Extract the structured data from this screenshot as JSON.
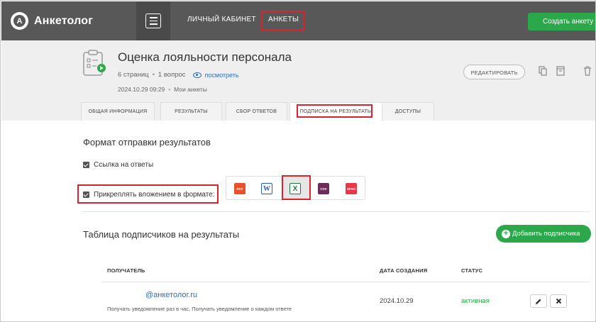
{
  "topbar": {
    "logo_letter": "A",
    "logo_text": "Анкетолог",
    "nav": {
      "cabinet": "ЛИЧНЫЙ КАБИНЕТ",
      "surveys": "АНКЕТЫ"
    },
    "create_button": "Создать анкету"
  },
  "survey": {
    "title": "Оценка лояльности персонала",
    "pages": "6 страниц",
    "questions": "1 вопрос",
    "view_link": "посмотреть",
    "date": "2024.10.29 09:29",
    "folder": "Мои анкеты",
    "edit_button": "РЕДАКТИРОВАТЬ"
  },
  "tabs": [
    {
      "label": "ОБЩАЯ ИНФОРМАЦИЯ"
    },
    {
      "label": "РЕЗУЛЬТАТЫ"
    },
    {
      "label": "СБОР ОТВЕТОВ"
    },
    {
      "label": "ПОДПИСКА НА РЕЗУЛЬТАТЫ"
    },
    {
      "label": "ДОСТУПЫ"
    }
  ],
  "active_tab": "ПОДПИСКА НА РЕЗУЛЬТАТЫ",
  "send_format": {
    "title": "Формат отправки результатов",
    "link_option": "Ссылка на ответы",
    "attach_option": "Прикреплять вложением в формате:",
    "formats": [
      {
        "name": "pdf-icon",
        "label": "PDF",
        "color": "#e8502a"
      },
      {
        "name": "word-icon",
        "label": "W",
        "color": "#2b5db0"
      },
      {
        "name": "excel-icon",
        "label": "X",
        "color": "#1e7a3c",
        "selected": true
      },
      {
        "name": "csv-icon",
        "label": "CSV",
        "color": "#6b2d5c"
      },
      {
        "name": "spss-icon",
        "label": "SPSS",
        "color": "#e53848"
      }
    ]
  },
  "subscribers": {
    "title": "Таблица подписчиков на результаты",
    "add_button": "Добавить подписчика",
    "columns": {
      "recipient": "ПОЛУЧАТЕЛЬ",
      "created": "ДАТА СОЗДАНИЯ",
      "status": "СТАТУС"
    },
    "rows": [
      {
        "recipient": "@анкетолог.ru",
        "note": "Получать уведомление раз в час, Получать уведомление о каждом ответе",
        "created": "2024.10.29",
        "status": "активная"
      }
    ]
  },
  "colors": {
    "accent_green": "#2aa84a",
    "status_active": "#2aa84a",
    "highlight_red": "#d9232e",
    "link_blue": "#2e6ec0",
    "topbar": "#585858"
  }
}
